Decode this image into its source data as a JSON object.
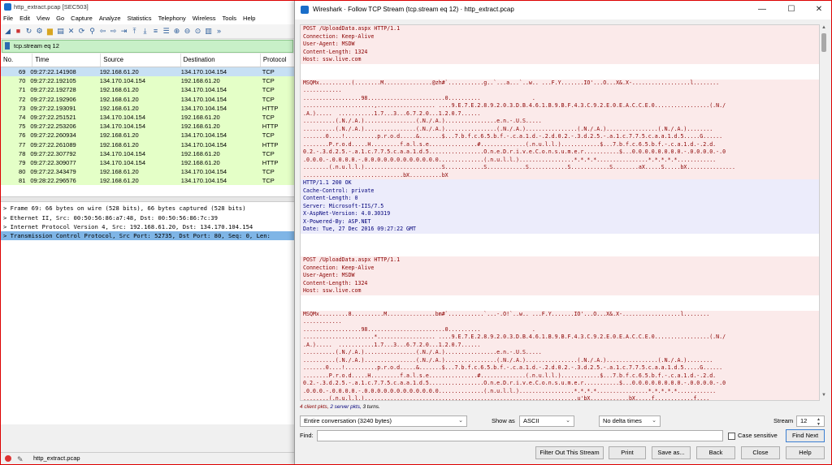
{
  "main_window": {
    "title": "http_extract.pcap [SEC503]",
    "menu": [
      "File",
      "Edit",
      "View",
      "Go",
      "Capture",
      "Analyze",
      "Statistics",
      "Telephony",
      "Wireless",
      "Tools",
      "Help"
    ],
    "filter": "tcp.stream eq 12",
    "columns": [
      "No.",
      "Time",
      "Source",
      "Destination",
      "Protocol"
    ],
    "packets": [
      {
        "no": "69",
        "time": "09:27:22.141908",
        "src": "192.168.61.20",
        "dst": "134.170.104.154",
        "proto": "TCP",
        "selected": true
      },
      {
        "no": "70",
        "time": "09:27:22.192105",
        "src": "134.170.104.154",
        "dst": "192.168.61.20",
        "proto": "TCP"
      },
      {
        "no": "71",
        "time": "09:27:22.192728",
        "src": "192.168.61.20",
        "dst": "134.170.104.154",
        "proto": "TCP"
      },
      {
        "no": "72",
        "time": "09:27:22.192906",
        "src": "192.168.61.20",
        "dst": "134.170.104.154",
        "proto": "TCP"
      },
      {
        "no": "73",
        "time": "09:27:22.193091",
        "src": "192.168.61.20",
        "dst": "134.170.104.154",
        "proto": "HTTP"
      },
      {
        "no": "74",
        "time": "09:27:22.251521",
        "src": "134.170.104.154",
        "dst": "192.168.61.20",
        "proto": "TCP"
      },
      {
        "no": "75",
        "time": "09:27:22.253206",
        "src": "134.170.104.154",
        "dst": "192.168.61.20",
        "proto": "HTTP"
      },
      {
        "no": "76",
        "time": "09:27:22.260934",
        "src": "192.168.61.20",
        "dst": "134.170.104.154",
        "proto": "TCP"
      },
      {
        "no": "77",
        "time": "09:27:22.261089",
        "src": "192.168.61.20",
        "dst": "134.170.104.154",
        "proto": "HTTP"
      },
      {
        "no": "78",
        "time": "09:27:22.307792",
        "src": "134.170.104.154",
        "dst": "192.168.61.20",
        "proto": "TCP"
      },
      {
        "no": "79",
        "time": "09:27:22.309077",
        "src": "134.170.104.154",
        "dst": "192.168.61.20",
        "proto": "HTTP"
      },
      {
        "no": "80",
        "time": "09:27:22.343479",
        "src": "192.168.61.20",
        "dst": "134.170.104.154",
        "proto": "TCP"
      },
      {
        "no": "81",
        "time": "09:28:22.296576",
        "src": "192.168.61.20",
        "dst": "134.170.104.154",
        "proto": "TCP"
      }
    ],
    "details": [
      "Frame 69: 66 bytes on wire (528 bits), 66 bytes captured (528 bits)",
      "Ethernet II, Src: 00:50:56:86:a7:48, Dst: 00:50:56:86:7c:39",
      "Internet Protocol Version 4, Src: 192.168.61.20, Dst: 134.170.104.154",
      "Transmission Control Protocol, Src Port: 52735, Dst Port: 80, Seq: 0, Len:"
    ],
    "status_file": "http_extract.pcap"
  },
  "dialog": {
    "title": "Wireshark · Follow TCP Stream (tcp.stream eq 12) · http_extract.pcap",
    "stream_lines": [
      {
        "t": "c",
        "s": "POST /UploadData.aspx HTTP/1.1"
      },
      {
        "t": "c",
        "s": "Connection: Keep-Alive"
      },
      {
        "t": "c",
        "s": "User-Agent: MSDW"
      },
      {
        "t": "c",
        "s": "Content-Length: 1324"
      },
      {
        "t": "c",
        "s": "Host: ssw.live.com"
      },
      {
        "t": "b",
        "s": ""
      },
      {
        "t": "b",
        "s": ""
      },
      {
        "t": "c",
        "s": "MSQMx..........(........M...............@zh#`...........g..`...a...`..w.. ...F.Y.......IO'...O...X&.X-..................l........"
      },
      {
        "t": "c",
        "s": "............"
      },
      {
        "t": "c",
        "s": "..................98........................0..........                ."
      },
      {
        "t": "c",
        "s": "......................,.................. ....9.E.7.E.2.8.9.2.0.3.D.B.4.6.1.B.9.B.F.4.3.C.9.2.E.0.E.A.C.C.E.0.................(.N./"
      },
      {
        "t": "c",
        "s": ".A.).....  ...........1.7...3...6.7.2.0...1.2.0.7......"
      },
      {
        "t": "c",
        "s": "..........(.N./.A.)................(.N./.A.)................e.n.-.U.S....."
      },
      {
        "t": "c",
        "s": "..........(.N./.A.)................(.N./.A.)................(.N./.A.)................(.N./.A.)................(.N./.A.)........"
      },
      {
        "t": "c",
        "s": ".......0....!..........p.r.o.d.....&.......$...7.b.f.c.6.5.b.f.-.c.a.1.d.-.2.d.0.2.-.3.d.2.5.-.a.1.c.7.7.5.c.a.a.1.d.5.....G......"
      },
      {
        "t": "c",
        "s": "........P.r.o.d.....H.........f.a.l.s.e...............#..............(.n.u.l.l.)............$...7.b.f.c.6.5.b.f.-.c.a.1.d.-.2.d."
      },
      {
        "t": "c",
        "s": "0.2.-.3.d.2.5.-.a.1.c.7.7.5.c.a.a.1.d.5.................O.n.e.D.r.i.v.e.C.o.n.s.u.m.e.r...........$...0.0.0.0.0.0.0.0.-.0.0.0.0.-.0"
      },
      {
        "t": "c",
        "s": ".0.0.0.-.0.0.0.0.-.0.0.0.0.0.0.0.0.0.0.0.0..............(.n.u.l.l.).................*.*.*.*................*.*.*.*.*............"
      },
      {
        "t": "c",
        "s": "........(.n.u.l.l.)........................S............S............S............S............S........aX.....S.....bX..............."
      },
      {
        "t": "c",
        "s": "...............................bX..........bX"
      },
      {
        "t": "s",
        "s": "HTTP/1.1 200 OK"
      },
      {
        "t": "s",
        "s": "Cache-Control: private"
      },
      {
        "t": "s",
        "s": "Content-Length: 0"
      },
      {
        "t": "s",
        "s": "Server: Microsoft-IIS/7.5"
      },
      {
        "t": "s",
        "s": "X-AspNet-Version: 4.0.30319"
      },
      {
        "t": "s",
        "s": "X-Powered-By: ASP.NET"
      },
      {
        "t": "s",
        "s": "Date: Tue, 27 Dec 2016 09:27:22 GMT"
      },
      {
        "t": "b",
        "s": ""
      },
      {
        "t": "b",
        "s": ""
      },
      {
        "t": "b",
        "s": ""
      },
      {
        "t": "c",
        "s": "POST /UploadData.aspx HTTP/1.1"
      },
      {
        "t": "c",
        "s": "Connection: Keep-Alive"
      },
      {
        "t": "c",
        "s": "User-Agent: MSDW"
      },
      {
        "t": "c",
        "s": "Content-Length: 1324"
      },
      {
        "t": "c",
        "s": "Host: ssw.live.com"
      },
      {
        "t": "b",
        "s": ""
      },
      {
        "t": "b",
        "s": ""
      },
      {
        "t": "c",
        "s": "MSQMx.........8..........M...............bm#`...........`...-.O!`..w.. ...F.Y.......IO'...O...X&.X-..................l........"
      },
      {
        "t": "c",
        "s": "............"
      },
      {
        "t": "c",
        "s": "..................98........................0..........                ."
      },
      {
        "t": "c",
        "s": "......................*.................. ....9.E.7.E.2.8.9.2.0.3.D.B.4.6.1.B.9.B.F.4.3.C.9.2.E.0.E.A.C.C.E.0.................(.N./"
      },
      {
        "t": "c",
        "s": ".A.).....  ...........1.7...3...6.7.2.0...1.2.0.7......"
      },
      {
        "t": "c",
        "s": "..........(.N./.A.)................(.N./.A.)................e.n.-.U.S....."
      },
      {
        "t": "c",
        "s": "..........(.N./.A.)................(.N./.A.)................(.N./.A.)................(.N./.A.)................(.N./.A.)........"
      },
      {
        "t": "c",
        "s": ".......0....!..........p.r.o.d.....&.......$...7.b.f.c.6.5.b.f.-.c.a.1.d.-.2.d.0.2.-.3.d.2.5.-.a.1.c.7.7.5.c.a.a.1.d.5.....G......"
      },
      {
        "t": "c",
        "s": "........P.r.o.d.....H.........f.a.l.s.e...............#..............(.n.u.l.l.)............$...7.b.f.c.6.5.b.f.-.c.a.1.d.-.2.d."
      },
      {
        "t": "c",
        "s": "0.2.-.3.d.2.5.-.a.1.c.7.7.5.c.a.a.1.d.5.................O.n.e.D.r.i.v.e.C.o.n.s.u.m.e.r...........$...0.0.0.0.0.0.0.0.-.0.0.0.0.-.0"
      },
      {
        "t": "c",
        "s": ".0.0.0.-.0.0.0.0.-.0.0.0.0.0.0.0.0.0.0.0.0..............(.n.u.l.l.).................*.*.*.*................*.*.*.*.*............"
      },
      {
        "t": "c",
        "s": "........(.n.u.l.l.)..................................................................u'bX............bX.....f............f...."
      }
    ],
    "summary": {
      "client": "4 client pkts,",
      "server": "2 server pkts,",
      "turns": "3 turns."
    },
    "conversation": "Entire conversation (3240 bytes)",
    "show_as_label": "Show as",
    "show_as": "ASCII",
    "delta": "No delta times",
    "stream_label": "Stream",
    "stream_no": "12",
    "find_label": "Find:",
    "find_value": "",
    "case_sensitive": "Case sensitive",
    "buttons": {
      "find_next": "Find Next",
      "filter_out": "Filter Out This Stream",
      "print": "Print",
      "save_as": "Save as...",
      "back": "Back",
      "close": "Close",
      "help": "Help"
    }
  },
  "colors": {
    "client": "#8a0000",
    "server": "#00007a",
    "packet_row": "#e4ffc7",
    "selected_row": "#c7e0f4",
    "filter_ok": "#c8f0c8"
  }
}
